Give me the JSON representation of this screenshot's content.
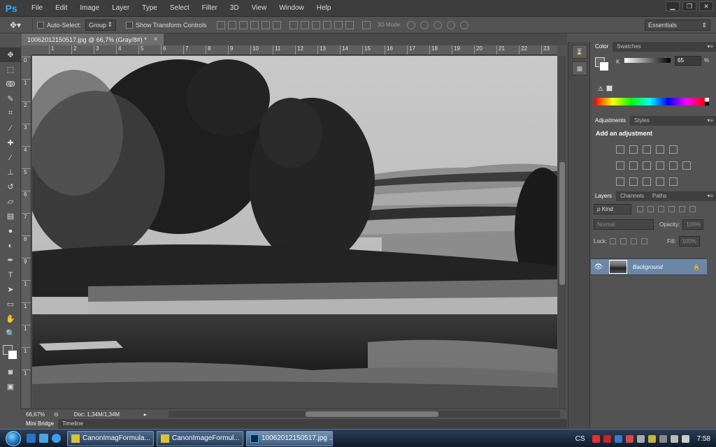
{
  "app": {
    "logo": "Ps",
    "menu": [
      "File",
      "Edit",
      "Image",
      "Layer",
      "Type",
      "Select",
      "Filter",
      "3D",
      "View",
      "Window",
      "Help"
    ],
    "window_controls": [
      "▁",
      "❐",
      "✕"
    ]
  },
  "options_bar": {
    "auto_select_label": "Auto-Select:",
    "auto_select_value": "Group",
    "show_transform_label": "Show Transform Controls",
    "mode_3d_label": "3D Mode:",
    "workspace": "Essentials"
  },
  "document": {
    "tab_title": "10062012150517.jpg @ 66,7% (Gray/8#) *",
    "zoom": "66,67%",
    "doc_info": "Doc: 1,34M/1,34M",
    "ruler_top": [
      "0",
      "1",
      "2",
      "3",
      "4",
      "5",
      "6",
      "7",
      "8",
      "9",
      "10",
      "11",
      "12",
      "13",
      "14",
      "15",
      "16",
      "17",
      "18",
      "19",
      "20",
      "21",
      "22",
      "23"
    ],
    "ruler_left": [
      "0",
      "1",
      "2",
      "3",
      "4",
      "5",
      "6",
      "7",
      "8",
      "9",
      "1",
      "1",
      "1",
      "1",
      "1"
    ]
  },
  "bottom_tabs": [
    "Mini Bridge",
    "Timeline"
  ],
  "tools": [
    {
      "icon": "move-icon",
      "glyph": "✥"
    },
    {
      "icon": "marquee-icon",
      "glyph": "⬚"
    },
    {
      "icon": "lasso-icon",
      "glyph": "ↂ"
    },
    {
      "icon": "quick-select-icon",
      "glyph": "✎"
    },
    {
      "icon": "crop-icon",
      "glyph": "⌗"
    },
    {
      "icon": "eyedropper-icon",
      "glyph": "⁄"
    },
    {
      "icon": "healing-brush-icon",
      "glyph": "✚"
    },
    {
      "icon": "brush-icon",
      "glyph": "∕"
    },
    {
      "icon": "clone-stamp-icon",
      "glyph": "⊥"
    },
    {
      "icon": "history-brush-icon",
      "glyph": "↺"
    },
    {
      "icon": "eraser-icon",
      "glyph": "▱"
    },
    {
      "icon": "gradient-icon",
      "glyph": "▤"
    },
    {
      "icon": "blur-icon",
      "glyph": "●"
    },
    {
      "icon": "dodge-icon",
      "glyph": "◐"
    },
    {
      "icon": "pen-icon",
      "glyph": "✒"
    },
    {
      "icon": "type-icon",
      "glyph": "T"
    },
    {
      "icon": "path-select-icon",
      "glyph": "➤"
    },
    {
      "icon": "shape-icon",
      "glyph": "▭"
    },
    {
      "icon": "hand-icon",
      "glyph": "✋"
    },
    {
      "icon": "zoom-icon",
      "glyph": "🔍"
    }
  ],
  "color_panel": {
    "tabs": [
      "Color",
      "Swatches"
    ],
    "channel_label": "K",
    "value": "65",
    "unit": "%",
    "warning_glyph": "⚠"
  },
  "adjustments_panel": {
    "tabs": [
      "Adjustments",
      "Styles"
    ],
    "title": "Add an adjustment"
  },
  "layers_panel": {
    "tabs": [
      "Layers",
      "Channels",
      "Paths"
    ],
    "filter_kind": "Kind",
    "blend_mode": "Normal",
    "opacity_label": "Opacity:",
    "opacity_value": "100%",
    "lock_label": "Lock:",
    "fill_label": "Fill:",
    "fill_value": "100%",
    "layers": [
      {
        "name": "Background",
        "visible": true,
        "locked": true
      }
    ]
  },
  "taskbar": {
    "tasks": [
      "CanonImagFormula...",
      "CanonImageFormul...",
      "10062012150517.jpg ..."
    ],
    "lang": "CS",
    "clock": "7:58"
  },
  "colors": {
    "ps_blue": "#31a8ff",
    "layer_selected": "#6b87a8",
    "panel_bg": "#535353"
  }
}
